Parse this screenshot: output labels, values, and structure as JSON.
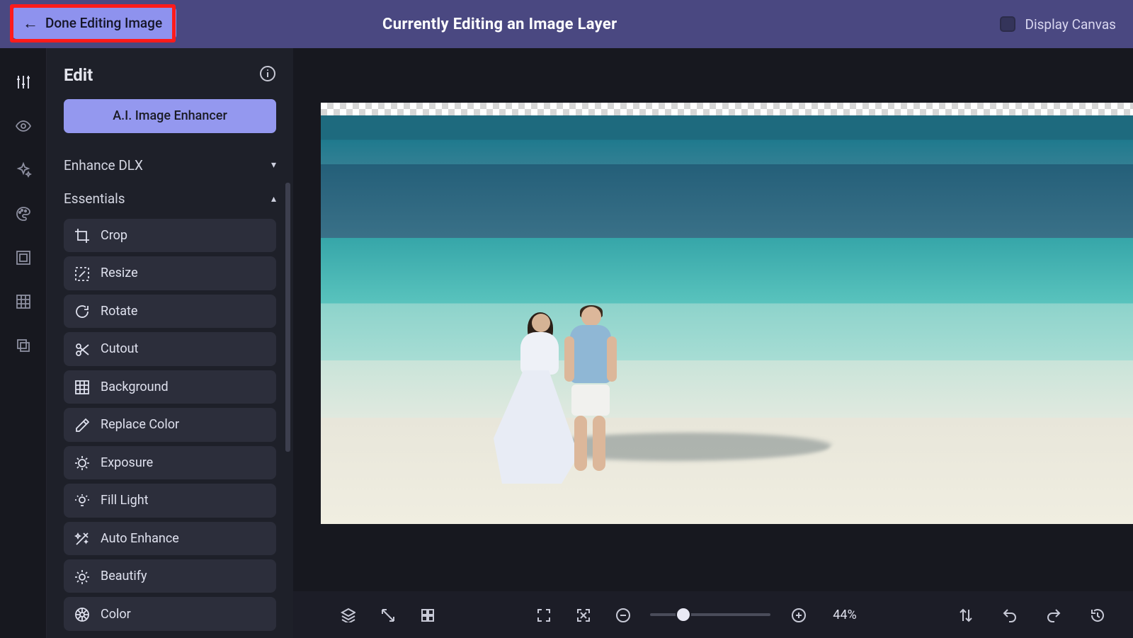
{
  "topbar": {
    "back_label": "Done Editing Image",
    "title": "Currently Editing an Image Layer",
    "display_canvas_label": "Display Canvas"
  },
  "panel": {
    "title": "Edit",
    "ai_button": "A.I. Image Enhancer",
    "groups": {
      "enhance_dlx": "Enhance DLX",
      "essentials": "Essentials"
    },
    "tools": [
      {
        "id": "crop",
        "label": "Crop"
      },
      {
        "id": "resize",
        "label": "Resize"
      },
      {
        "id": "rotate",
        "label": "Rotate"
      },
      {
        "id": "cutout",
        "label": "Cutout"
      },
      {
        "id": "background",
        "label": "Background"
      },
      {
        "id": "replace-color",
        "label": "Replace Color"
      },
      {
        "id": "exposure",
        "label": "Exposure"
      },
      {
        "id": "fill-light",
        "label": "Fill Light"
      },
      {
        "id": "auto-enhance",
        "label": "Auto Enhance"
      },
      {
        "id": "beautify",
        "label": "Beautify"
      },
      {
        "id": "color",
        "label": "Color"
      }
    ]
  },
  "bottombar": {
    "zoom_percent": "44%"
  },
  "rail_icons": [
    "adjust-icon",
    "eye-icon",
    "sparkle-icon",
    "palette-icon",
    "frame-icon",
    "pattern-icon",
    "layers-icon"
  ],
  "colors": {
    "accent": "#9498ef",
    "topbar": "#4a4881",
    "panel": "#1e2029",
    "tool": "#2c2e3b"
  }
}
